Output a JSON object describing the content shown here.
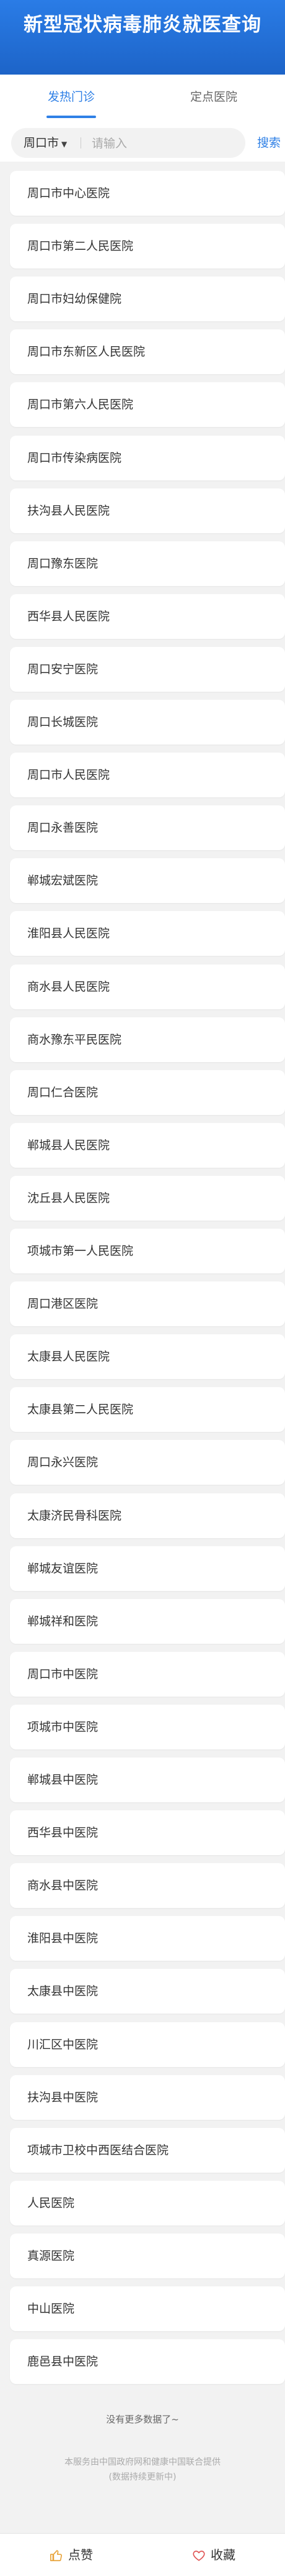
{
  "header": {
    "title": "新型冠状病毒肺炎就医查询"
  },
  "tabs": [
    {
      "label": "发热门诊",
      "active": true
    },
    {
      "label": "定点医院",
      "active": false
    }
  ],
  "search": {
    "city": "周口市",
    "placeholder": "请输入",
    "value": "",
    "button_label": "搜索"
  },
  "hospitals": [
    "周口市中心医院",
    "周口市第二人民医院",
    "周口市妇幼保健院",
    "周口市东新区人民医院",
    "周口市第六人民医院",
    "周口市传染病医院",
    "扶沟县人民医院",
    "周口豫东医院",
    "西华县人民医院",
    "周口安宁医院",
    "周口长城医院",
    "周口市人民医院",
    "周口永善医院",
    "郸城宏斌医院",
    "淮阳县人民医院",
    "商水县人民医院",
    "商水豫东平民医院",
    "周口仁合医院",
    "郸城县人民医院",
    "沈丘县人民医院",
    "项城市第一人民医院",
    "周口港区医院",
    "太康县人民医院",
    "太康县第二人民医院",
    "周口永兴医院",
    "太康济民骨科医院",
    "郸城友谊医院",
    "郸城祥和医院",
    "周口市中医院",
    "项城市中医院",
    "郸城县中医院",
    "西华县中医院",
    "商水县中医院",
    "淮阳县中医院",
    "太康县中医院",
    "川汇区中医院",
    "扶沟县中医院",
    "项城市卫校中西医结合医院",
    "人民医院",
    "真源医院",
    "中山医院",
    "鹿邑县中医院"
  ],
  "list_end_text": "没有更多数据了~",
  "footer": {
    "line1": "本服务由中国政府网和健康中国联合提供",
    "line2": "(数据持续更新中)"
  },
  "bottom_bar": {
    "like_label": "点赞",
    "favorite_label": "收藏"
  },
  "colors": {
    "header_bg": "#1d64c8",
    "accent": "#2f80e6",
    "like_icon": "#e8a33a",
    "favorite_icon": "#e05555"
  }
}
